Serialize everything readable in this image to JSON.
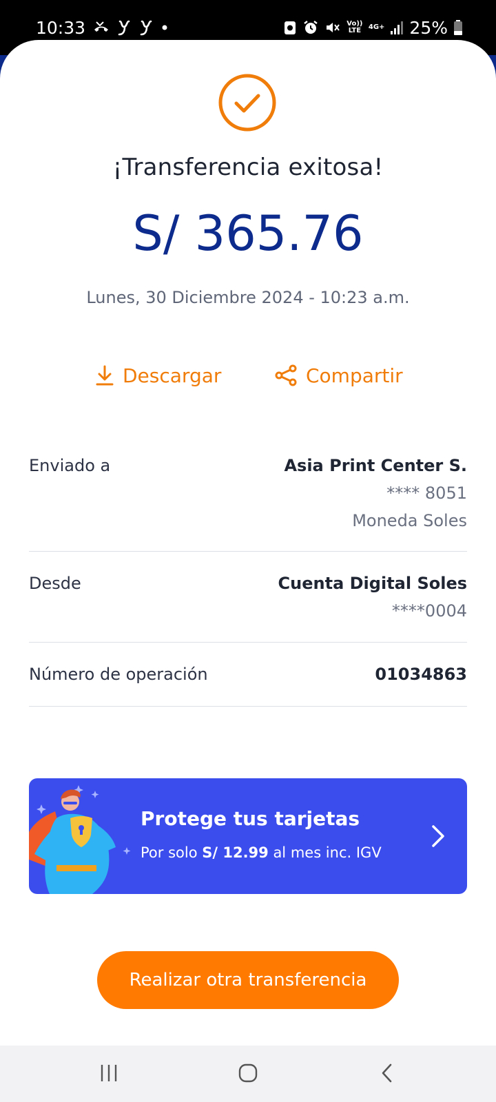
{
  "status_bar": {
    "time": "10:33",
    "battery": "25%",
    "volte_label": "Vo)) LTE",
    "network_label": "4G+"
  },
  "receipt": {
    "title": "¡Transferencia exitosa!",
    "amount": "S/ 365.76",
    "datetime": "Lunes, 30 Diciembre 2024 - 10:23 a.m.",
    "accent_color": "#f07c0a",
    "amount_color": "#0d2b8c"
  },
  "actions": {
    "download_label": "Descargar",
    "share_label": "Compartir"
  },
  "details": {
    "sent_to": {
      "label": "Enviado a",
      "name": "Asia Print Center S.",
      "account": "**** 8051",
      "currency": "Moneda Soles"
    },
    "from": {
      "label": "Desde",
      "name": "Cuenta Digital Soles",
      "account": "****0004"
    },
    "operation": {
      "label": "Número de operación",
      "number": "01034863"
    }
  },
  "promo": {
    "title": "Protege tus tarjetas",
    "sub_prefix": "Por solo ",
    "sub_price": "S/ 12.99",
    "sub_suffix": " al mes inc. IGV",
    "bg_color": "#3c4ded"
  },
  "cta": {
    "label": "Realizar otra transferencia",
    "color": "#ff7a00"
  },
  "nav": {
    "recents": "recents-icon",
    "home": "home-icon",
    "back": "back-icon"
  }
}
